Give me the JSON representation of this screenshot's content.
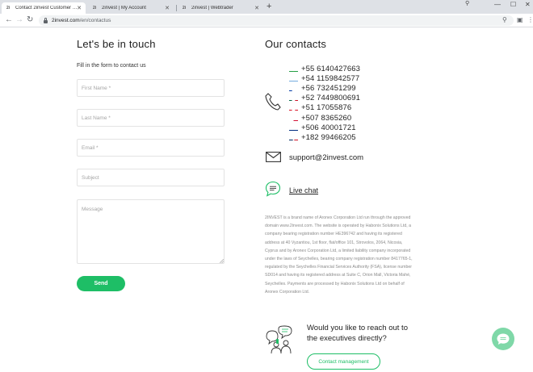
{
  "browser": {
    "tabs": [
      {
        "title": "Contact 2invest Customer Servic",
        "active": true
      },
      {
        "title": "2invest | My Account",
        "active": false
      },
      {
        "title": "2invest | Webtrader",
        "active": false
      }
    ],
    "favicon_text": "2i",
    "url_host": "2invest.com",
    "url_path": "/en/contactus"
  },
  "form": {
    "heading": "Let's be in touch",
    "subtext": "Fill in the form to contact us",
    "first_name_placeholder": "First Name *",
    "last_name_placeholder": "Last Name *",
    "email_placeholder": "Email *",
    "subject_placeholder": "Subject",
    "message_placeholder": "Message",
    "send_label": "Send"
  },
  "contacts": {
    "heading": "Our contacts",
    "phones": [
      {
        "country": "BR",
        "number": "+55 6140427663"
      },
      {
        "country": "AR",
        "number": "+54 1159842577"
      },
      {
        "country": "CL",
        "number": "+56 732451299"
      },
      {
        "country": "MX",
        "number": "+52 7449800691"
      },
      {
        "country": "PE",
        "number": "+51 17055876"
      },
      {
        "country": "PA",
        "number": "+507 8365260"
      },
      {
        "country": "CR",
        "number": "+506 40001721"
      },
      {
        "country": "DO",
        "number": "+182 99466205"
      }
    ],
    "email": "support@2invest.com",
    "live_chat": "Live chat",
    "disclaimer": "2INVEST is a brand name of Aronex Corporation Ltd run through the approved domain www.2invest.com. The website is operated by Habonix Solutions Ltd, a company bearing registration number HE396742 and having its registered address at 40 Vyzantiou, 1st floor, flat/office 101, Strovolos, 2064, Nicosia, Cyprus and by Aronex Corporation Ltd, a limited liability company incorporated under the laws of Seychelles, bearing company registration number 8417765-1, regulated by the Seychelles Financial Services Authority (FSA), license number SD014 and having its registered address at Suite C, Orion Mall, Victoria Mahé, Seychelles. Payments are processed by Habonix Solutions Ltd on behalf of Aronex Corporation Ltd.",
    "executives_question": "Would you like to reach out to the executives directly?",
    "contact_management": "Contact management"
  },
  "icons": {
    "phone": "phone-handset-icon",
    "mail": "envelope-icon",
    "chat": "speech-bubble-icon",
    "executives": "people-with-speech-bubbles-icon",
    "fab": "chat-bubble-icon"
  },
  "colors": {
    "accent_green": "#1ebe66",
    "fab_green": "#7fd8a8",
    "text_dark": "#1f1f1f",
    "text_muted": "#8a8a8a"
  }
}
